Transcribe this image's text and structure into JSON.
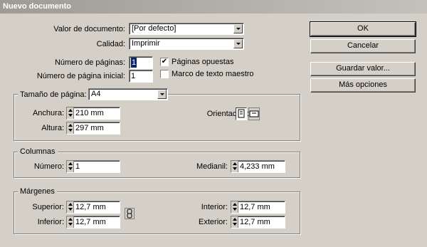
{
  "window": {
    "title": "Nuevo documento"
  },
  "form": {
    "preset_label": "Valor de documento:",
    "preset_value": "[Por defecto]",
    "quality_label": "Calidad:",
    "quality_value": "Imprimir",
    "pages_label": "Número de páginas:",
    "pages_value": "1",
    "start_page_label": "Número de página inicial:",
    "start_page_value": "1",
    "facing_pages_label": "Páginas opuestas",
    "facing_pages_checked": true,
    "master_text_label": "Marco de texto maestro",
    "master_text_checked": false
  },
  "page_size": {
    "label": "Tamaño de página:",
    "value": "A4",
    "width_label": "Anchura:",
    "width_value": "210 mm",
    "height_label": "Altura:",
    "height_value": "297 mm",
    "orientation_label": "Orientación:",
    "orientation_selected": "portrait"
  },
  "columns": {
    "legend": "Columnas",
    "number_label": "Número:",
    "number_value": "1",
    "gutter_label": "Medianil:",
    "gutter_value": "4,233 mm"
  },
  "margins": {
    "legend": "Márgenes",
    "top_label": "Superior:",
    "top_value": "12,7 mm",
    "bottom_label": "Inferior:",
    "bottom_value": "12,7 mm",
    "inside_label": "Interior:",
    "inside_value": "12,7 mm",
    "outside_label": "Exterior:",
    "outside_value": "12,7 mm"
  },
  "buttons": {
    "ok": "OK",
    "cancel": "Cancelar",
    "save_preset": "Guardar valor...",
    "more_options": "Más opciones"
  },
  "icons": {
    "portrait": "portrait-page-icon",
    "landscape": "landscape-page-icon",
    "link": "chain-link-icon"
  }
}
